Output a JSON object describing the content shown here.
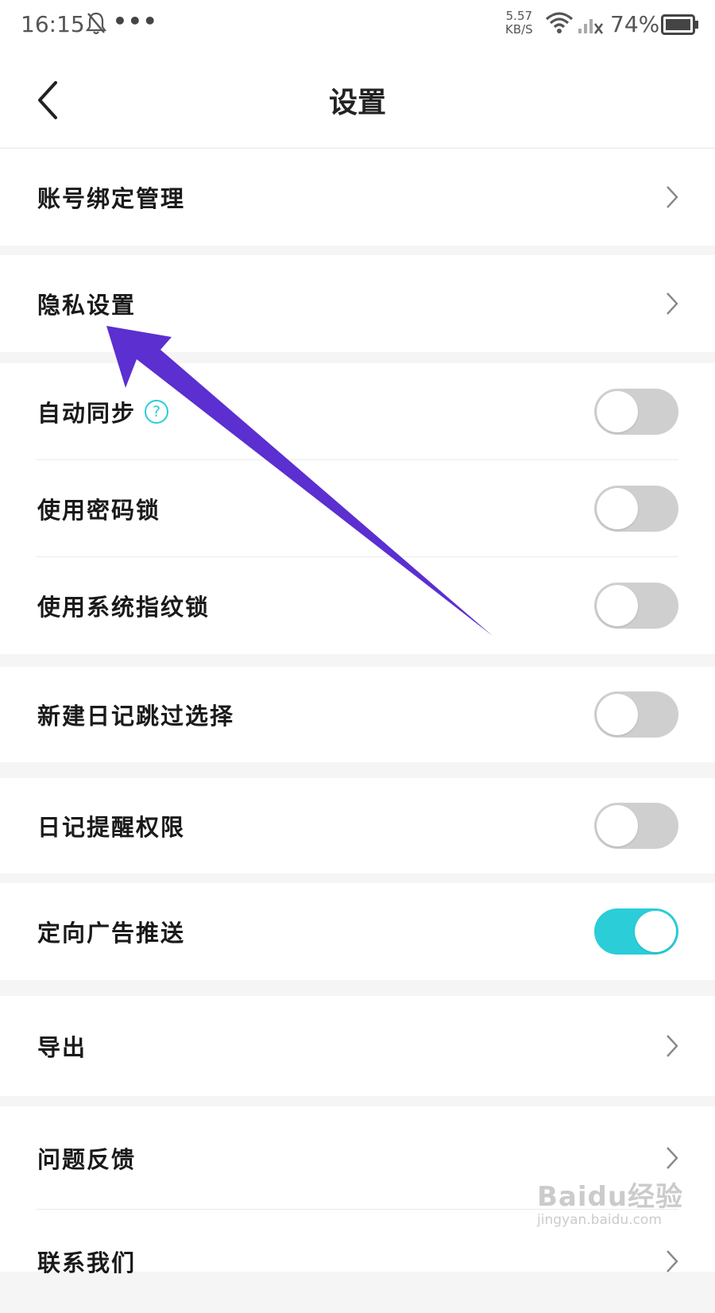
{
  "status_bar": {
    "time": "16:15",
    "notification_icon": "bell-off-icon",
    "more": "•••",
    "network_speed": "5.57",
    "network_speed_unit": "KB/S",
    "battery": "74%"
  },
  "header": {
    "back_icon": "chevron-left-icon",
    "title": "设置"
  },
  "settings": {
    "account_binding": "账号绑定管理",
    "privacy": "隐私设置",
    "auto_sync": "自动同步",
    "auto_sync_help": "?",
    "password_lock": "使用密码锁",
    "fingerprint_lock": "使用系统指纹锁",
    "skip_selection": "新建日记跳过选择",
    "reminder_permission": "日记提醒权限",
    "targeted_ads": "定向广告推送",
    "export": "导出",
    "feedback": "问题反馈",
    "contact": "联系我们"
  },
  "toggles": {
    "auto_sync": false,
    "password_lock": false,
    "fingerprint_lock": false,
    "skip_selection": false,
    "reminder_permission": false,
    "targeted_ads": true
  },
  "colors": {
    "accent": "#2bcdd8",
    "annotation_arrow": "#5b2fd0",
    "toggle_off": "#cfcfcf"
  },
  "watermark": {
    "brand": "Baidu经验",
    "url": "jingyan.baidu.com"
  }
}
